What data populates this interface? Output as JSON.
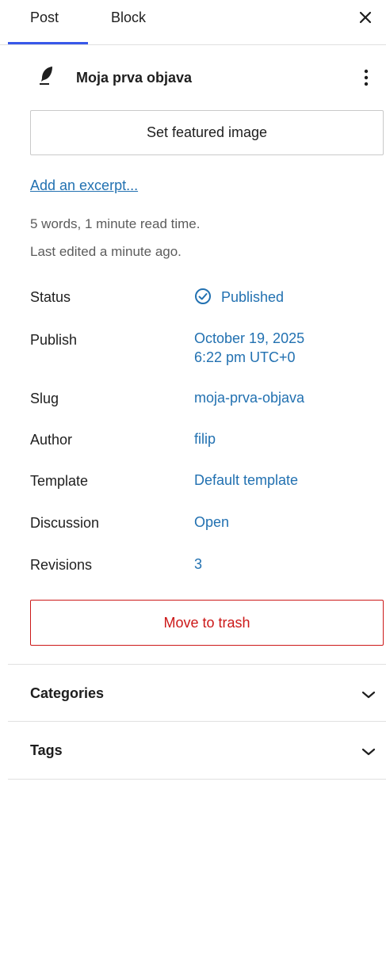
{
  "tabs": {
    "post": "Post",
    "block": "Block",
    "close_icon": "close-icon"
  },
  "post": {
    "title": "Moja prva objava",
    "icon": "feather-icon",
    "more_icon": "more-vertical-icon"
  },
  "featured_image": {
    "label": "Set featured image"
  },
  "excerpt": {
    "label": "Add an excerpt..."
  },
  "meta": {
    "words": "5 words, 1 minute read time.",
    "edited": "Last edited a minute ago."
  },
  "rows": {
    "status": {
      "label": "Status",
      "value": "Published",
      "icon": "check-circle-icon"
    },
    "publish": {
      "label": "Publish",
      "value_line1": "October 19, 2025",
      "value_line2": "6:22 pm UTC+0"
    },
    "slug": {
      "label": "Slug",
      "value": "moja-prva-objava"
    },
    "author": {
      "label": "Author",
      "value": "filip"
    },
    "template": {
      "label": "Template",
      "value": "Default template"
    },
    "discussion": {
      "label": "Discussion",
      "value": "Open"
    },
    "revisions": {
      "label": "Revisions",
      "value": "3"
    }
  },
  "trash": {
    "label": "Move to trash"
  },
  "panels": {
    "categories": "Categories",
    "tags": "Tags",
    "chevron_icon": "chevron-down-icon"
  },
  "colors": {
    "accent": "#3858e9",
    "link": "#2271b1",
    "danger": "#cc1818",
    "border": "#e0e0e0"
  }
}
